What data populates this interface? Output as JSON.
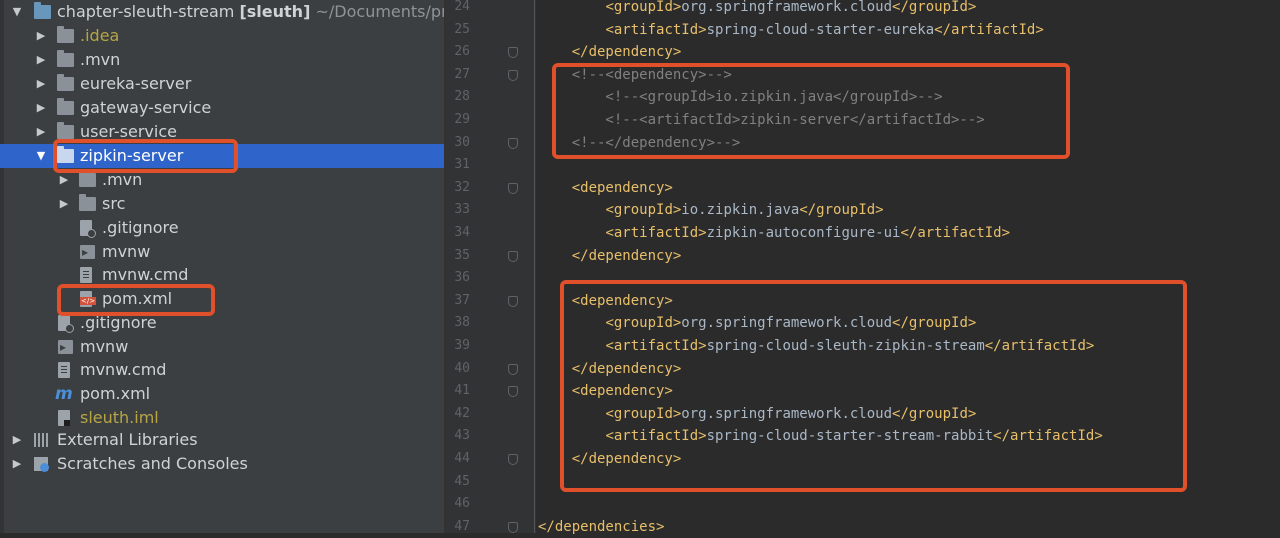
{
  "project_tree": {
    "root": {
      "name": "chapter-sleuth-stream",
      "module": "[sleuth]",
      "path": "~/Documents/pro"
    },
    "items": [
      {
        "label": ".idea",
        "icon": "folder-icon",
        "kind": "folder",
        "expanded": false,
        "style": "yellow"
      },
      {
        "label": ".mvn",
        "icon": "folder-icon",
        "kind": "folder",
        "expanded": false
      },
      {
        "label": "eureka-server",
        "icon": "folder-icon",
        "kind": "folder",
        "expanded": false
      },
      {
        "label": "gateway-service",
        "icon": "folder-icon",
        "kind": "folder",
        "expanded": false
      },
      {
        "label": "user-service",
        "icon": "folder-icon",
        "kind": "folder",
        "expanded": false
      },
      {
        "label": "zipkin-server",
        "icon": "folder-icon",
        "kind": "folder",
        "expanded": true,
        "selected": true
      },
      {
        "label": ".mvn",
        "icon": "folder-icon",
        "kind": "folder",
        "expanded": false
      },
      {
        "label": "src",
        "icon": "folder-icon",
        "kind": "folder",
        "expanded": false
      },
      {
        "label": ".gitignore",
        "icon": "gitignore-file-icon",
        "kind": "file"
      },
      {
        "label": "mvnw",
        "icon": "terminal-file-icon",
        "kind": "file"
      },
      {
        "label": "mvnw.cmd",
        "icon": "text-file-icon",
        "kind": "file"
      },
      {
        "label": "pom.xml",
        "icon": "xml-file-icon",
        "kind": "file"
      },
      {
        "label": ".gitignore",
        "icon": "gitignore-file-icon",
        "kind": "file"
      },
      {
        "label": "mvnw",
        "icon": "terminal-file-icon",
        "kind": "file"
      },
      {
        "label": "mvnw.cmd",
        "icon": "text-file-icon",
        "kind": "file"
      },
      {
        "label": "pom.xml",
        "icon": "maven-icon",
        "kind": "file"
      },
      {
        "label": "sleuth.iml",
        "icon": "iml-file-icon",
        "kind": "file",
        "style": "yellow"
      }
    ],
    "external_libraries": "External Libraries",
    "scratches": "Scratches and Consoles"
  },
  "editor": {
    "lines": [
      {
        "n": "24",
        "text": "        <groupId>org.springframework.cloud</groupId>"
      },
      {
        "n": "25",
        "text": "        <artifactId>spring-cloud-starter-eureka</artifactId>"
      },
      {
        "n": "26",
        "text": "    </dependency>"
      },
      {
        "n": "27",
        "text": "    <!--<dependency>-->"
      },
      {
        "n": "28",
        "text": "        <!--<groupId>io.zipkin.java</groupId>-->"
      },
      {
        "n": "29",
        "text": "        <!--<artifactId>zipkin-server</artifactId>-->"
      },
      {
        "n": "30",
        "text": "    <!--</dependency>-->"
      },
      {
        "n": "31",
        "text": ""
      },
      {
        "n": "32",
        "text": "    <dependency>"
      },
      {
        "n": "33",
        "text": "        <groupId>io.zipkin.java</groupId>"
      },
      {
        "n": "34",
        "text": "        <artifactId>zipkin-autoconfigure-ui</artifactId>"
      },
      {
        "n": "35",
        "text": "    </dependency>"
      },
      {
        "n": "36",
        "text": ""
      },
      {
        "n": "37",
        "text": "    <dependency>"
      },
      {
        "n": "38",
        "text": "        <groupId>org.springframework.cloud</groupId>"
      },
      {
        "n": "39",
        "text": "        <artifactId>spring-cloud-sleuth-zipkin-stream</artifactId>"
      },
      {
        "n": "40",
        "text": "    </dependency>"
      },
      {
        "n": "41",
        "text": "    <dependency>"
      },
      {
        "n": "42",
        "text": "        <groupId>org.springframework.cloud</groupId>"
      },
      {
        "n": "43",
        "text": "        <artifactId>spring-cloud-starter-stream-rabbit</artifactId>"
      },
      {
        "n": "44",
        "text": "    </dependency>"
      },
      {
        "n": "45",
        "text": ""
      },
      {
        "n": "46",
        "text": ""
      },
      {
        "n": "47",
        "text": "</dependencies>"
      }
    ]
  },
  "colors": {
    "highlight_box": "#e0502b",
    "selection": "#2f65ca",
    "xml_tag": "#e8bf6a",
    "xml_text": "#a9b7c6",
    "comment": "#808080"
  }
}
